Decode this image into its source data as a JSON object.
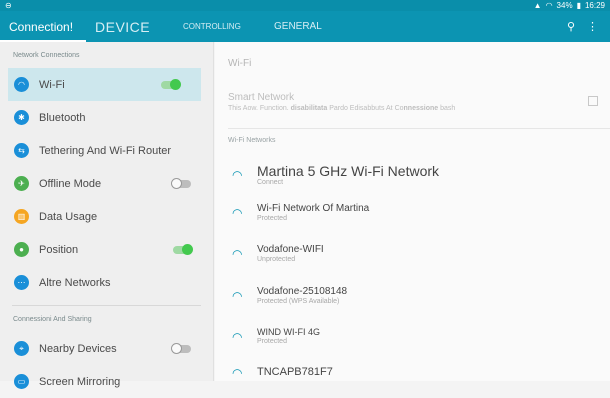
{
  "status": {
    "time": "16:29",
    "battery": "34%"
  },
  "tabs": [
    "Connection!",
    "DEVICE",
    "CONTROLLING",
    "GENERAL"
  ],
  "left": {
    "section1": "Network Connections",
    "items": [
      {
        "label": "Wi-Fi",
        "icon": "wifi-icon",
        "color": "#1a8fd8",
        "toggle": "on"
      },
      {
        "label": "Bluetooth",
        "icon": "bluetooth-icon",
        "color": "#1a8fd8",
        "toggle": ""
      },
      {
        "label": "Tethering And Wi-Fi Router",
        "icon": "tethering-icon",
        "color": "#1a8fd8",
        "toggle": ""
      },
      {
        "label": "Offline Mode",
        "icon": "airplane-icon",
        "color": "#4caf50",
        "toggle": "off"
      },
      {
        "label": "Data Usage",
        "icon": "data-usage-icon",
        "color": "#f5a623",
        "toggle": ""
      },
      {
        "label": "Position",
        "icon": "location-icon",
        "color": "#4caf50",
        "toggle": "on"
      },
      {
        "label": "Altre Networks",
        "icon": "more-networks-icon",
        "color": "#1a8fd8",
        "toggle": ""
      }
    ],
    "section2": "Connessioni And Sharing",
    "items2": [
      {
        "label": "Nearby Devices",
        "icon": "nearby-icon",
        "color": "#1a8fd8",
        "toggle": "off"
      },
      {
        "label": "Screen Mirroring",
        "icon": "mirror-icon",
        "color": "#1a8fd8",
        "toggle": ""
      }
    ]
  },
  "right": {
    "title": "Wi-Fi",
    "smart_network": "Smart Network",
    "smart_desc_a": "This Aow. Function.",
    "smart_desc_b": "disabilitata",
    "smart_desc_c": "Pardo Edisabbuts At Co",
    "smart_desc_d": "nnessione",
    "smart_desc_e": "bash",
    "networks_label": "Wi-Fi Networks",
    "networks": [
      {
        "name": "Martina 5 GHz Wi-Fi Network",
        "status": "Connect"
      },
      {
        "name": "Wi-Fi Network Of Martina",
        "status": "Protected"
      },
      {
        "name": "Vodafone-WIFI",
        "status": "Unprotected"
      },
      {
        "name": "Vodafone-25108148",
        "status": "Protected (WPS Available)"
      },
      {
        "name": "WIND WI-FI 4G",
        "status": "Protected"
      },
      {
        "name": "TNCAPB781F7",
        "status": ""
      }
    ]
  }
}
